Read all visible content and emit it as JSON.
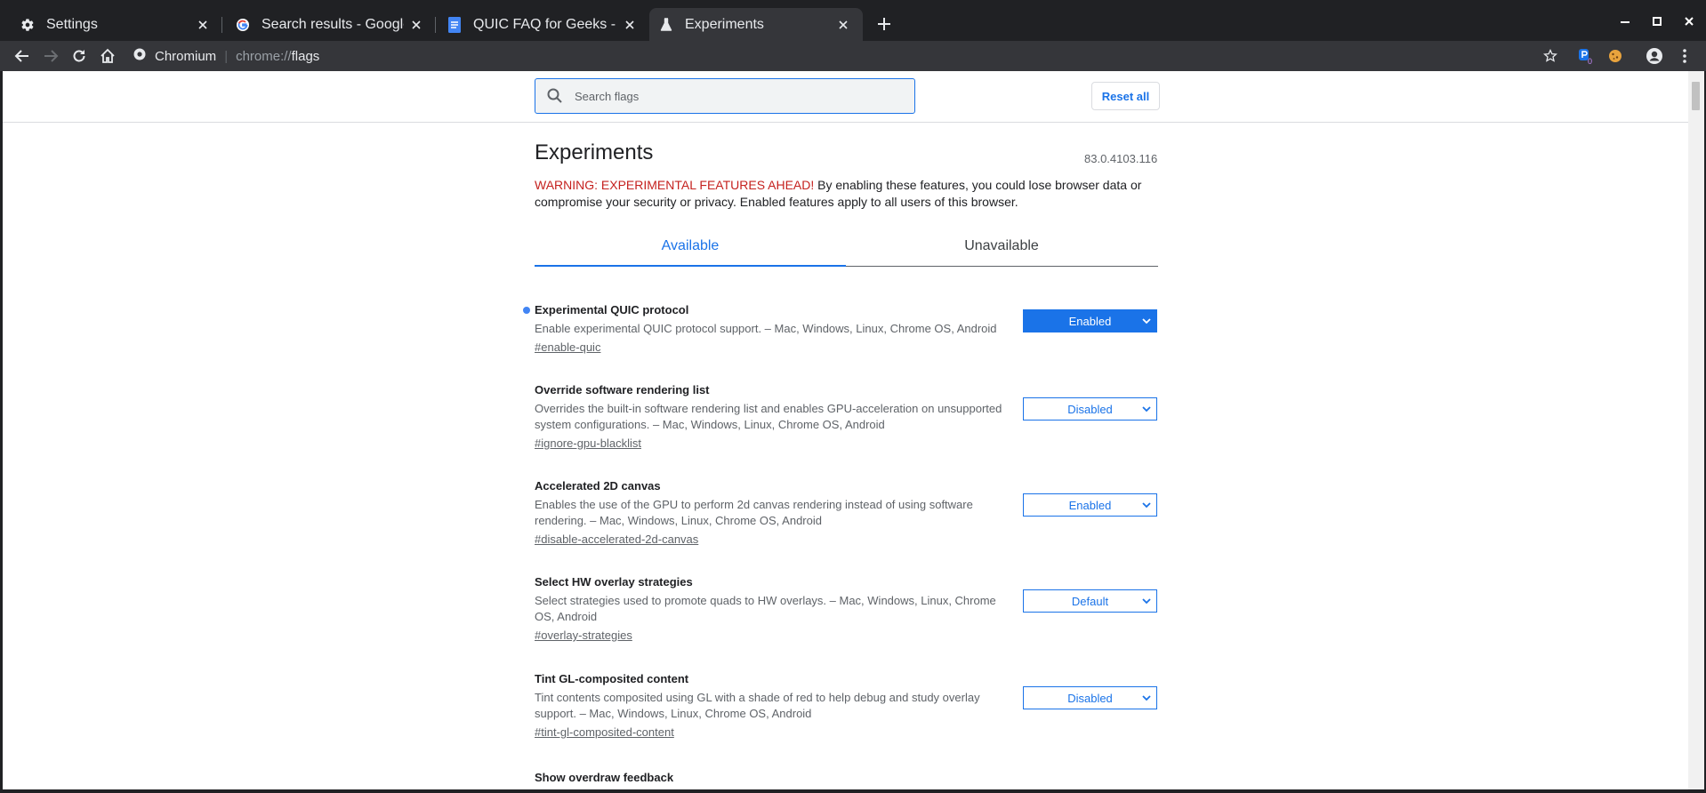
{
  "browser": {
    "tabs": [
      {
        "title": "Settings",
        "icon": "gear-icon"
      },
      {
        "title": "Search results - Google Chrome Help",
        "icon": "google-icon"
      },
      {
        "title": "QUIC FAQ for Geeks - Google Docs",
        "icon": "docs-icon"
      },
      {
        "title": "Experiments",
        "icon": "flask-icon",
        "active": true
      }
    ],
    "omnibox": {
      "site": "Chromium",
      "scheme": "chrome://",
      "path": "flags"
    },
    "extension_badge": "0"
  },
  "page": {
    "search_placeholder": "Search flags",
    "reset_label": "Reset all",
    "title": "Experiments",
    "version": "83.0.4103.116",
    "warning_prefix": "WARNING: EXPERIMENTAL FEATURES AHEAD!",
    "warning_text": " By enabling these features, you could lose browser data or compromise your security or privacy. Enabled features apply to all users of this browser.",
    "tab_available": "Available",
    "tab_unavailable": "Unavailable"
  },
  "experiments": [
    {
      "name": "Experimental QUIC protocol",
      "description": "Enable experimental QUIC protocol support. – Mac, Windows, Linux, Chrome OS, Android",
      "link": "#enable-quic",
      "value": "Enabled",
      "modified": true
    },
    {
      "name": "Override software rendering list",
      "description": "Overrides the built-in software rendering list and enables GPU-acceleration on unsupported system configurations. – Mac, Windows, Linux, Chrome OS, Android",
      "link": "#ignore-gpu-blacklist",
      "value": "Disabled",
      "modified": false
    },
    {
      "name": "Accelerated 2D canvas",
      "description": "Enables the use of the GPU to perform 2d canvas rendering instead of using software rendering. – Mac, Windows, Linux, Chrome OS, Android",
      "link": "#disable-accelerated-2d-canvas",
      "value": "Enabled",
      "modified": false
    },
    {
      "name": "Select HW overlay strategies",
      "description": "Select strategies used to promote quads to HW overlays. – Mac, Windows, Linux, Chrome OS, Android",
      "link": "#overlay-strategies",
      "value": "Default",
      "modified": false
    },
    {
      "name": "Tint GL-composited content",
      "description": "Tint contents composited using GL with a shade of red to help debug and study overlay support. – Mac, Windows, Linux, Chrome OS, Android",
      "link": "#tint-gl-composited-content",
      "value": "Disabled",
      "modified": false
    },
    {
      "name": "Show overdraw feedback"
    }
  ],
  "colors": {
    "accent": "#1a73e8",
    "warning": "#c5221f",
    "frame": "#202124",
    "toolbar": "#35363a"
  }
}
